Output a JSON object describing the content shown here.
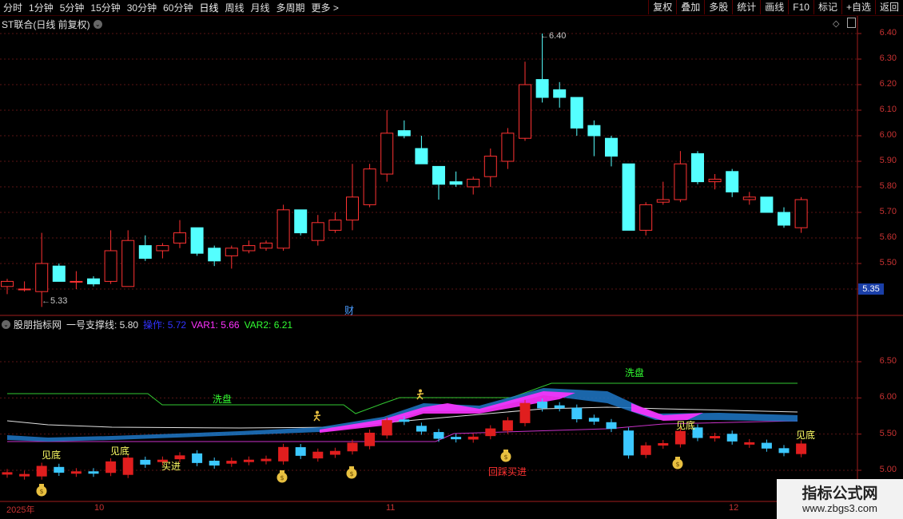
{
  "toolbar": {
    "periods": [
      "分时",
      "1分钟",
      "5分钟",
      "15分钟",
      "30分钟",
      "60分钟",
      "日线",
      "周线",
      "月线",
      "多周期",
      "更多 >"
    ],
    "active": "日线",
    "buttons": [
      "复权",
      "叠加",
      "多股",
      "统计",
      "画线",
      "F10",
      "标记",
      "+自选",
      "返回"
    ]
  },
  "main_panel": {
    "title": "ST联合(日线 前复权)",
    "high_label": "6.40",
    "low_label": "5.33",
    "current_price": "5.35",
    "event_label": "财",
    "y_ticks": [
      "6.40",
      "6.30",
      "6.20",
      "6.10",
      "6.00",
      "5.90",
      "5.80",
      "5.70",
      "5.60",
      "5.50",
      "5.40"
    ]
  },
  "indicator_panel": {
    "name": "股朋指标网",
    "support_label": "一号支撑线: 5.80",
    "op_label": "操作: 5.72",
    "var1_label": "VAR1: 5.66",
    "var2_label": "VAR2: 6.21",
    "op_color": "#3232ff",
    "var1_color": "#ff32ff",
    "var2_color": "#32ff32",
    "y_ticks": [
      "6.50",
      "6.00",
      "5.50",
      "5.00"
    ],
    "signals": {
      "xipan1": "洗盘",
      "xipan2": "洗盘",
      "jiandi1": "见底",
      "jiandi2": "见底",
      "jiandi3": "见底",
      "jiandi4": "见底",
      "mairu": "买进",
      "huicai": "回踩买进"
    }
  },
  "dates": [
    "2025年",
    "10",
    "11",
    "12"
  ],
  "watermark": {
    "line1": "指标公式网",
    "line2": "www.zbgs3.com"
  },
  "chart_data": {
    "type": "candlestick",
    "ylim": [
      5.35,
      6.45
    ],
    "candles": [
      {
        "o": 5.41,
        "h": 5.44,
        "l": 5.38,
        "c": 5.43
      },
      {
        "o": 5.4,
        "h": 5.43,
        "l": 5.39,
        "c": 5.4
      },
      {
        "o": 5.39,
        "h": 5.62,
        "l": 5.33,
        "c": 5.5
      },
      {
        "o": 5.49,
        "h": 5.5,
        "l": 5.43,
        "c": 5.43
      },
      {
        "o": 5.43,
        "h": 5.47,
        "l": 5.4,
        "c": 5.43
      },
      {
        "o": 5.44,
        "h": 5.45,
        "l": 5.41,
        "c": 5.42
      },
      {
        "o": 5.43,
        "h": 5.63,
        "l": 5.42,
        "c": 5.55
      },
      {
        "o": 5.41,
        "h": 5.63,
        "l": 5.41,
        "c": 5.59
      },
      {
        "o": 5.57,
        "h": 5.61,
        "l": 5.51,
        "c": 5.52
      },
      {
        "o": 5.55,
        "h": 5.58,
        "l": 5.52,
        "c": 5.57
      },
      {
        "o": 5.58,
        "h": 5.67,
        "l": 5.56,
        "c": 5.62
      },
      {
        "o": 5.64,
        "h": 5.64,
        "l": 5.53,
        "c": 5.54
      },
      {
        "o": 5.56,
        "h": 5.57,
        "l": 5.49,
        "c": 5.51
      },
      {
        "o": 5.53,
        "h": 5.57,
        "l": 5.48,
        "c": 5.56
      },
      {
        "o": 5.55,
        "h": 5.59,
        "l": 5.54,
        "c": 5.57
      },
      {
        "o": 5.56,
        "h": 5.59,
        "l": 5.55,
        "c": 5.58
      },
      {
        "o": 5.56,
        "h": 5.73,
        "l": 5.55,
        "c": 5.71
      },
      {
        "o": 5.71,
        "h": 5.71,
        "l": 5.61,
        "c": 5.62
      },
      {
        "o": 5.59,
        "h": 5.69,
        "l": 5.57,
        "c": 5.66
      },
      {
        "o": 5.63,
        "h": 5.7,
        "l": 5.62,
        "c": 5.67
      },
      {
        "o": 5.67,
        "h": 5.89,
        "l": 5.63,
        "c": 5.76
      },
      {
        "o": 5.73,
        "h": 5.89,
        "l": 5.72,
        "c": 5.87
      },
      {
        "o": 5.85,
        "h": 6.1,
        "l": 5.82,
        "c": 6.01
      },
      {
        "o": 6.02,
        "h": 6.06,
        "l": 5.99,
        "c": 6.0
      },
      {
        "o": 5.95,
        "h": 6.0,
        "l": 5.89,
        "c": 5.89
      },
      {
        "o": 5.88,
        "h": 5.88,
        "l": 5.75,
        "c": 5.81
      },
      {
        "o": 5.82,
        "h": 5.86,
        "l": 5.8,
        "c": 5.81
      },
      {
        "o": 5.8,
        "h": 5.84,
        "l": 5.77,
        "c": 5.83
      },
      {
        "o": 5.84,
        "h": 5.95,
        "l": 5.8,
        "c": 5.92
      },
      {
        "o": 5.9,
        "h": 6.03,
        "l": 5.87,
        "c": 6.01
      },
      {
        "o": 5.99,
        "h": 6.29,
        "l": 5.98,
        "c": 6.2
      },
      {
        "o": 6.22,
        "h": 6.4,
        "l": 6.13,
        "c": 6.15
      },
      {
        "o": 6.18,
        "h": 6.21,
        "l": 6.11,
        "c": 6.15
      },
      {
        "o": 6.15,
        "h": 6.15,
        "l": 6.0,
        "c": 6.03
      },
      {
        "o": 6.04,
        "h": 6.06,
        "l": 5.92,
        "c": 6.0
      },
      {
        "o": 5.99,
        "h": 6.0,
        "l": 5.88,
        "c": 5.92
      },
      {
        "o": 5.89,
        "h": 5.89,
        "l": 5.63,
        "c": 5.63
      },
      {
        "o": 5.63,
        "h": 5.74,
        "l": 5.61,
        "c": 5.73
      },
      {
        "o": 5.74,
        "h": 5.82,
        "l": 5.73,
        "c": 5.75
      },
      {
        "o": 5.75,
        "h": 5.94,
        "l": 5.74,
        "c": 5.89
      },
      {
        "o": 5.93,
        "h": 5.94,
        "l": 5.81,
        "c": 5.82
      },
      {
        "o": 5.82,
        "h": 5.85,
        "l": 5.79,
        "c": 5.83
      },
      {
        "o": 5.86,
        "h": 5.87,
        "l": 5.76,
        "c": 5.78
      },
      {
        "o": 5.75,
        "h": 5.78,
        "l": 5.73,
        "c": 5.76
      },
      {
        "o": 5.76,
        "h": 5.76,
        "l": 5.7,
        "c": 5.7
      },
      {
        "o": 5.7,
        "h": 5.72,
        "l": 5.64,
        "c": 5.65
      },
      {
        "o": 5.64,
        "h": 5.76,
        "l": 5.62,
        "c": 5.75
      }
    ]
  }
}
